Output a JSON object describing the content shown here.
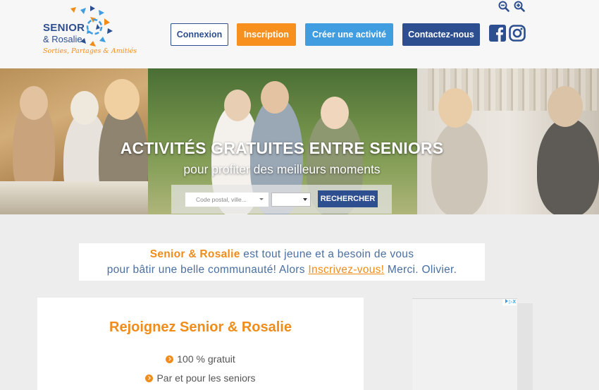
{
  "header": {
    "logo": {
      "line1": "SENIOR",
      "line2": "& Rosalie",
      "tagline": "Sorties, Partages & Amitiés"
    },
    "zoom_out_icon": "zoom-out-icon",
    "zoom_in_icon": "zoom-in-icon",
    "buttons": {
      "connexion": "Connexion",
      "inscription": "Inscription",
      "creer_activite": "Créer une activité",
      "contact": "Contactez-nous"
    },
    "social": [
      "facebook-icon",
      "instagram-icon"
    ]
  },
  "hero": {
    "title": "ACTIVITÉS GRATUITES ENTRE SENIORS",
    "subtitle": "pour profiter des meilleurs moments",
    "search": {
      "location_placeholder": "Code postal, ville...",
      "second_select_value": "",
      "button_label": "RECHERCHER"
    }
  },
  "message": {
    "brand": "Senior & Rosalie",
    "text1": " est tout jeune et a besoin de vous",
    "text2": "pour bâtir une belle communauté! Alors ",
    "link": "Inscrivez-vous!",
    "text3": " Merci. Olivier."
  },
  "join_card": {
    "title": "Rejoignez Senior & Rosalie",
    "features": [
      "100 % gratuit",
      "Par et pour les seniors"
    ]
  },
  "ad": {
    "adchoices": "▷X"
  },
  "colors": {
    "primary_blue": "#2d4e8f",
    "orange": "#f7901e",
    "light_blue": "#3f9de0"
  }
}
